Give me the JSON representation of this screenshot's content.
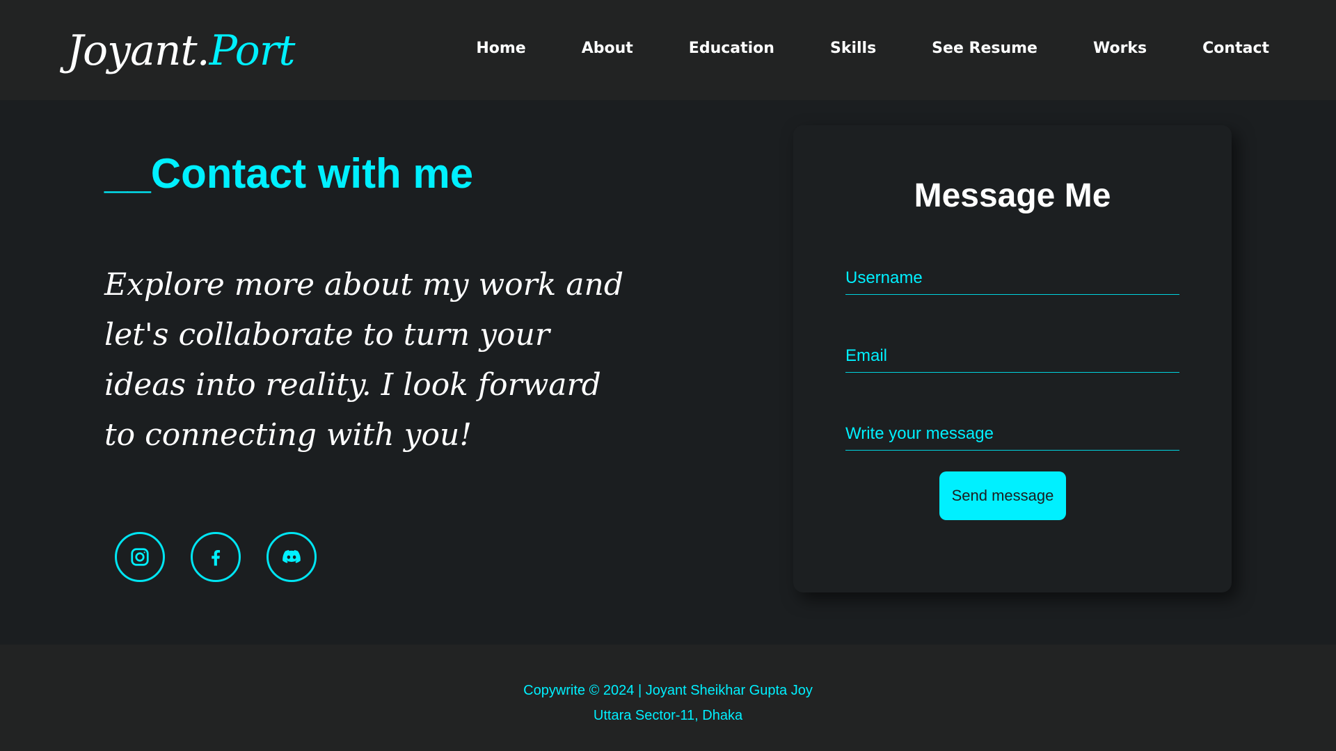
{
  "colors": {
    "accent": "#00f0ff",
    "background": "#1b1e20",
    "header_bg": "#222323",
    "card_bg": "#1c1f21"
  },
  "header": {
    "logo_primary": "Joyant.",
    "logo_secondary": "Port",
    "nav": [
      {
        "label": "Home"
      },
      {
        "label": "About"
      },
      {
        "label": "Education"
      },
      {
        "label": "Skills"
      },
      {
        "label": "See Resume"
      },
      {
        "label": "Works"
      },
      {
        "label": "Contact"
      }
    ]
  },
  "contact": {
    "title": "__Contact with me",
    "intro": "Explore more about my work and let's collaborate to turn your ideas into reality. I look forward to connecting with you!",
    "socials": [
      {
        "icon": "instagram-icon"
      },
      {
        "icon": "facebook-icon"
      },
      {
        "icon": "discord-icon"
      }
    ]
  },
  "form": {
    "title": "Message Me",
    "username_placeholder": "Username",
    "email_placeholder": "Email",
    "message_placeholder": "Write your message",
    "send_label": "Send message"
  },
  "footer": {
    "copyright": "Copywrite © 2024 | Joyant Sheikhar Gupta Joy",
    "address": "Uttara Sector-11, Dhaka"
  }
}
